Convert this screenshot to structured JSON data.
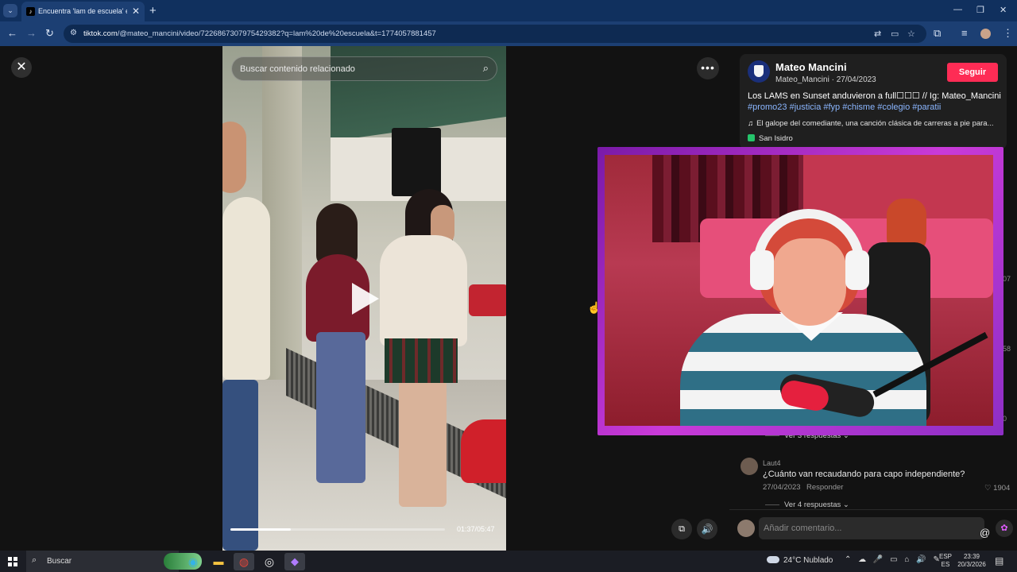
{
  "browser": {
    "tab_title": "Encuentra 'lam de escuela' en T",
    "tab_favicon": "tiktok-icon",
    "url_domain": "tiktok.com",
    "url_path": "/@mateo_mancini/video/7226867307975429382?q=lam%20de%20escuela&t=1774057881457"
  },
  "video": {
    "search_placeholder": "Buscar contenido relacionado",
    "time": "01:37/05:47",
    "progress": 0.28
  },
  "post": {
    "author_name": "Mateo Mancini",
    "author_meta": "Mateo_Mancini · 27/04/2023",
    "follow_label": "Seguir",
    "desc_text": "Los LAMS en Sunset anduvieron a full☐☐☐ // Ig: Mateo_Mancini",
    "hashtags": "#promo23 #justicia #fyp #chisme #colegio #paratii",
    "music": "El galope del comediante, una canción clásica de carreras a pie para...",
    "location": "San Isidro"
  },
  "side_counts": [
    "07",
    "58",
    "0"
  ],
  "comments": {
    "replies_1": "Ver 3 respuestas ⌄",
    "user": "Laut4",
    "text": "¿Cuánto van recaudando para capo independiente?",
    "date": "27/04/2023",
    "reply_label": "Responder",
    "likes": "♡ 1904",
    "replies_2": "Ver 4 respuestas ⌄",
    "input_placeholder": "Añadir comentario..."
  },
  "taskbar": {
    "search": "Buscar",
    "weather": "24°C  Nublado",
    "lang_1": "ESP",
    "lang_2": "ES",
    "time": "23:39",
    "date": "20/3/2026"
  },
  "colors": {
    "follow": "#fe2c55",
    "hashtag": "#8bb6ff",
    "browser_frame": "#1c3f73"
  }
}
